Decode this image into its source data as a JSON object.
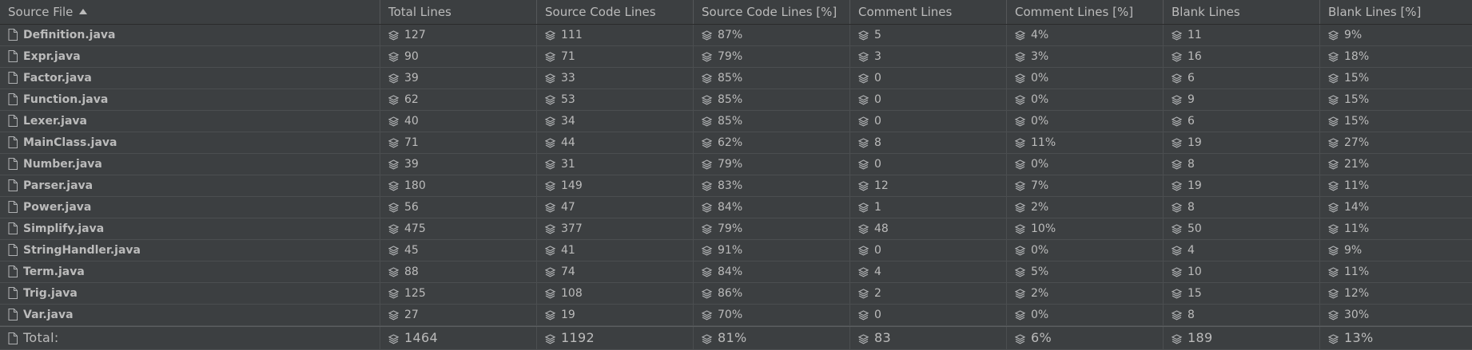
{
  "columns": [
    "Source File",
    "Total Lines",
    "Source Code Lines",
    "Source Code Lines [%]",
    "Comment Lines",
    "Comment Lines [%]",
    "Blank Lines",
    "Blank Lines [%]"
  ],
  "sort": {
    "column": "Source File",
    "direction": "ascending"
  },
  "row_icon": "file-icon",
  "value_icon": "layers-icon",
  "rows": [
    {
      "file": "Definition.java",
      "total": "127",
      "code": "111",
      "code_pct": "87%",
      "comment": "5",
      "comment_pct": "4%",
      "blank": "11",
      "blank_pct": "9%"
    },
    {
      "file": "Expr.java",
      "total": "90",
      "code": "71",
      "code_pct": "79%",
      "comment": "3",
      "comment_pct": "3%",
      "blank": "16",
      "blank_pct": "18%"
    },
    {
      "file": "Factor.java",
      "total": "39",
      "code": "33",
      "code_pct": "85%",
      "comment": "0",
      "comment_pct": "0%",
      "blank": "6",
      "blank_pct": "15%"
    },
    {
      "file": "Function.java",
      "total": "62",
      "code": "53",
      "code_pct": "85%",
      "comment": "0",
      "comment_pct": "0%",
      "blank": "9",
      "blank_pct": "15%"
    },
    {
      "file": "Lexer.java",
      "total": "40",
      "code": "34",
      "code_pct": "85%",
      "comment": "0",
      "comment_pct": "0%",
      "blank": "6",
      "blank_pct": "15%"
    },
    {
      "file": "MainClass.java",
      "total": "71",
      "code": "44",
      "code_pct": "62%",
      "comment": "8",
      "comment_pct": "11%",
      "blank": "19",
      "blank_pct": "27%"
    },
    {
      "file": "Number.java",
      "total": "39",
      "code": "31",
      "code_pct": "79%",
      "comment": "0",
      "comment_pct": "0%",
      "blank": "8",
      "blank_pct": "21%"
    },
    {
      "file": "Parser.java",
      "total": "180",
      "code": "149",
      "code_pct": "83%",
      "comment": "12",
      "comment_pct": "7%",
      "blank": "19",
      "blank_pct": "11%"
    },
    {
      "file": "Power.java",
      "total": "56",
      "code": "47",
      "code_pct": "84%",
      "comment": "1",
      "comment_pct": "2%",
      "blank": "8",
      "blank_pct": "14%"
    },
    {
      "file": "Simplify.java",
      "total": "475",
      "code": "377",
      "code_pct": "79%",
      "comment": "48",
      "comment_pct": "10%",
      "blank": "50",
      "blank_pct": "11%"
    },
    {
      "file": "StringHandler.java",
      "total": "45",
      "code": "41",
      "code_pct": "91%",
      "comment": "0",
      "comment_pct": "0%",
      "blank": "4",
      "blank_pct": "9%"
    },
    {
      "file": "Term.java",
      "total": "88",
      "code": "74",
      "code_pct": "84%",
      "comment": "4",
      "comment_pct": "5%",
      "blank": "10",
      "blank_pct": "11%"
    },
    {
      "file": "Trig.java",
      "total": "125",
      "code": "108",
      "code_pct": "86%",
      "comment": "2",
      "comment_pct": "2%",
      "blank": "15",
      "blank_pct": "12%"
    },
    {
      "file": "Var.java",
      "total": "27",
      "code": "19",
      "code_pct": "70%",
      "comment": "0",
      "comment_pct": "0%",
      "blank": "8",
      "blank_pct": "30%"
    }
  ],
  "total_row": {
    "file": "Total:",
    "total": "1464",
    "code": "1192",
    "code_pct": "81%",
    "comment": "83",
    "comment_pct": "6%",
    "blank": "189",
    "blank_pct": "13%"
  }
}
